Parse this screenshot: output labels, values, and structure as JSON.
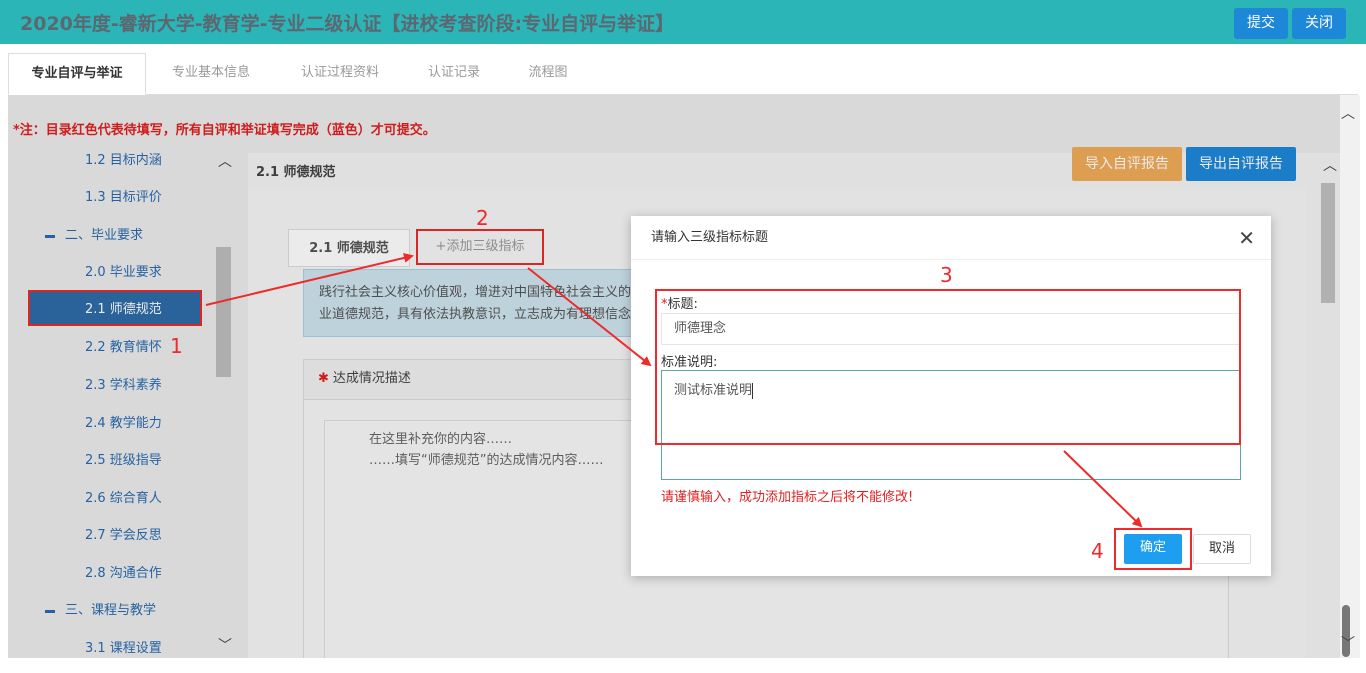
{
  "header": {
    "title": "2020年度-睿新大学-教育学-专业二级认证【进校考查阶段:专业自评与举证】",
    "submit_label": "提交",
    "close_label": "关闭"
  },
  "tabs": [
    {
      "label": "专业自评与举证",
      "active": true
    },
    {
      "label": "专业基本信息"
    },
    {
      "label": "认证过程资料"
    },
    {
      "label": "认证记录"
    },
    {
      "label": "流程图"
    }
  ],
  "note": "*注：目录红色代表待填写，所有自评和举证填写完成（蓝色）才可提交。",
  "tree": {
    "items": [
      {
        "label": "1.2 目标内涵",
        "level": 2
      },
      {
        "label": "1.3 目标评价",
        "level": 2
      },
      {
        "label": "二、毕业要求",
        "level": 1
      },
      {
        "label": "2.0 毕业要求",
        "level": 2
      },
      {
        "label": "2.1 师德规范",
        "level": 2,
        "selected": true
      },
      {
        "label": "2.2 教育情怀",
        "level": 2
      },
      {
        "label": "2.3 学科素养",
        "level": 2
      },
      {
        "label": "2.4 教学能力",
        "level": 2
      },
      {
        "label": "2.5 班级指导",
        "level": 2
      },
      {
        "label": "2.6 综合育人",
        "level": 2
      },
      {
        "label": "2.7 学会反思",
        "level": 2
      },
      {
        "label": "2.8 沟通合作",
        "level": 2
      },
      {
        "label": "三、课程与教学",
        "level": 1
      },
      {
        "label": "3.1 课程设置",
        "level": 2
      }
    ]
  },
  "content": {
    "breadcrumb": "2.1 师德规范",
    "import_label": "导入自评报告",
    "export_label": "导出自评报告",
    "subtab_label": "2.1 师德规范",
    "add_indicator_label": "+添加三级指标",
    "info_line1": "践行社会主义核心价值观，增进对中国特色社会主义的",
    "info_line2": "业道德规范，具有依法执教意识，立志成为有理想信念",
    "panel_title": "达成情况描述",
    "editor_line1": "在这里补充你的内容……",
    "editor_line2": "……填写“师德规范”的达成情况内容……"
  },
  "modal": {
    "title": "请输入三级指标标题",
    "title_label": "标题:",
    "title_value": "师德理念",
    "desc_label": "标准说明:",
    "desc_value": "测试标准说明",
    "warning": "请谨慎输入，成功添加指标之后将不能修改!",
    "ok_label": "确定",
    "cancel_label": "取消"
  },
  "annotations": [
    "1",
    "2",
    "3",
    "4"
  ],
  "colors": {
    "header_bg": "#2cb5b6",
    "primary": "#1e88d8",
    "warning_orange": "#f0ac5a",
    "annotation_red": "#ee2a2a",
    "tree_selected": "#2d6ca8"
  }
}
